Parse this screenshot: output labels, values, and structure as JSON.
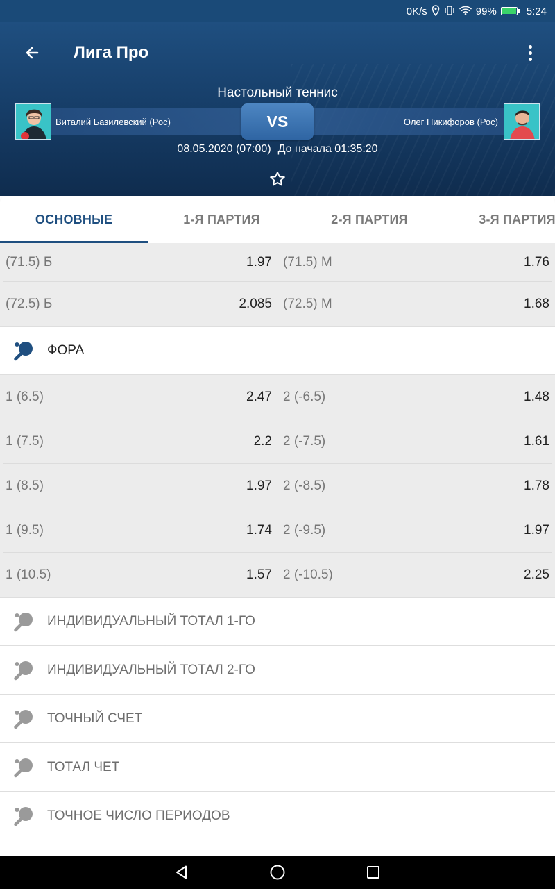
{
  "status_bar": {
    "speed": "0K/s",
    "battery_percent": "99%",
    "battery_level": 0.99,
    "time": "5:24",
    "icons": [
      "location-icon",
      "vibrate-icon",
      "wifi-icon",
      "battery-icon"
    ]
  },
  "header": {
    "title": "Лига Про",
    "sport": "Настольный теннис",
    "team1": "Виталий Базилевский (Рос)",
    "team2": "Олег Никифоров (Рос)",
    "vs": "VS",
    "datetime": "08.05.2020 (07:00)",
    "countdown": "До начала 01:35:20"
  },
  "tabs": [
    "ОСНОВНЫЕ",
    "1-Я ПАРТИЯ",
    "2-Я ПАРТИЯ",
    "3-Я ПАРТИЯ"
  ],
  "active_tab": "ОСНОВНЫЕ",
  "total_rows": [
    {
      "left_label": "(71.5) Б",
      "left_value": "1.97",
      "right_label": "(71.5) М",
      "right_value": "1.76"
    },
    {
      "left_label": "(72.5) Б",
      "left_value": "2.085",
      "right_label": "(72.5) М",
      "right_value": "1.68"
    }
  ],
  "fora": {
    "title": "ФОРА",
    "rows": [
      {
        "left_label": "1 (6.5)",
        "left_value": "2.47",
        "right_label": "2 (-6.5)",
        "right_value": "1.48"
      },
      {
        "left_label": "1 (7.5)",
        "left_value": "2.2",
        "right_label": "2 (-7.5)",
        "right_value": "1.61"
      },
      {
        "left_label": "1 (8.5)",
        "left_value": "1.97",
        "right_label": "2 (-8.5)",
        "right_value": "1.78"
      },
      {
        "left_label": "1 (9.5)",
        "left_value": "1.74",
        "right_label": "2 (-9.5)",
        "right_value": "1.97"
      },
      {
        "left_label": "1 (10.5)",
        "left_value": "1.57",
        "right_label": "2 (-10.5)",
        "right_value": "2.25"
      }
    ]
  },
  "sections": [
    "ИНДИВИДУАЛЬНЫЙ ТОТАЛ 1-ГО",
    "ИНДИВИДУАЛЬНЫЙ ТОТАЛ 2-ГО",
    "ТОЧНЫЙ СЧЕТ",
    "ТОТАЛ ЧЕТ",
    "ТОЧНОЕ ЧИСЛО ПЕРИОДОВ"
  ],
  "colors": {
    "header_blue": "#1f4f80",
    "accent": "#1f4f80",
    "row_bg": "#ececec",
    "active_icon": "#1f4f80",
    "inactive_icon": "#9a9a9a"
  }
}
